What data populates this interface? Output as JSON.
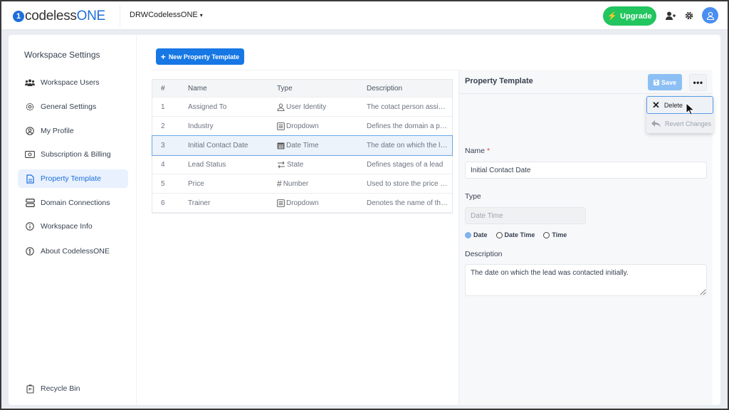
{
  "topbar": {
    "logo_mark": "1",
    "logo_text_main": "codeless",
    "logo_text_accent": "ONE",
    "workspace_name": "DRWCodelessONE",
    "workspace_caret": "▾",
    "upgrade_label": "Upgrade",
    "upgrade_icon": "⚡",
    "colors": {
      "brand": "#1e6fd9",
      "upgrade": "#22c55e",
      "avatar": "#4a8ef0"
    }
  },
  "sidebar": {
    "title": "Workspace Settings",
    "items": [
      {
        "label": "Workspace Users",
        "icon": "users-icon",
        "active": false
      },
      {
        "label": "General Settings",
        "icon": "gear-icon",
        "active": false
      },
      {
        "label": "My Profile",
        "icon": "profile-icon",
        "active": false
      },
      {
        "label": "Subscription & Billing",
        "icon": "billing-icon",
        "active": false
      },
      {
        "label": "Property Template",
        "icon": "document-icon",
        "active": true
      },
      {
        "label": "Domain Connections",
        "icon": "server-icon",
        "active": false
      },
      {
        "label": "Workspace Info",
        "icon": "info-icon",
        "active": false
      },
      {
        "label": "About CodelessONE",
        "icon": "codelessone-icon",
        "active": false
      }
    ],
    "recycle_bin": "Recycle Bin"
  },
  "main": {
    "new_button": "New Property Template",
    "table": {
      "headers": [
        "#",
        "Name",
        "Type",
        "Description"
      ],
      "rows": [
        {
          "num": "1",
          "name": "Assigned To",
          "type": "User Identity",
          "type_icon": "user-icon",
          "desc": "The cotact person assig..."
        },
        {
          "num": "2",
          "name": "Industry",
          "type": "Dropdown",
          "type_icon": "list-icon",
          "desc": "Defines the domain a pe..."
        },
        {
          "num": "3",
          "name": "Initial Contact Date",
          "type": "Date Time",
          "type_icon": "calendar-icon",
          "desc": "The date on which the le...",
          "selected": true
        },
        {
          "num": "4",
          "name": "Lead Status",
          "type": "State",
          "type_icon": "state-icon",
          "desc": "Defines stages of a lead"
        },
        {
          "num": "5",
          "name": "Price",
          "type": "Number",
          "type_icon": "hash-icon",
          "desc": "Used to store the price o..."
        },
        {
          "num": "6",
          "name": "Trainer",
          "type": "Dropdown",
          "type_icon": "list-icon",
          "desc": "Denotes the name of the..."
        }
      ]
    }
  },
  "panel": {
    "title": "Property Template",
    "save_label": "Save",
    "more_label": "•••",
    "menu": {
      "delete": "Delete",
      "revert": "Revert Changes"
    },
    "name_label": "Name",
    "required_mark": "*",
    "name_value": "Initial Contact Date",
    "type_label": "Type",
    "type_value": "Date Time",
    "format_options": [
      {
        "label": "Date",
        "checked": true
      },
      {
        "label": "Date Time",
        "checked": false
      },
      {
        "label": "Time",
        "checked": false
      }
    ],
    "description_label": "Description",
    "description_value": "The date on which the lead was contacted initially."
  }
}
